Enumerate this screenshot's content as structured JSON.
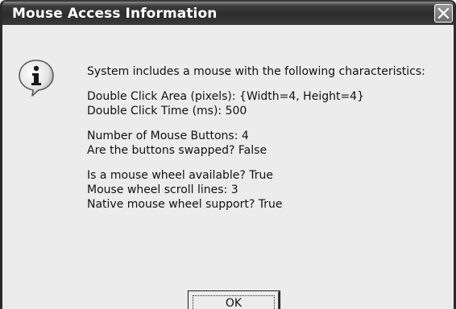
{
  "window": {
    "title": "Mouse Access Information"
  },
  "icons": {
    "info": "info-icon",
    "close": "close-icon"
  },
  "message": {
    "intro": "System includes a mouse with the following characteristics:",
    "double_click_area": "Double Click Area (pixels): {Width=4, Height=4}",
    "double_click_time": "Double Click Time (ms): 500",
    "button_count": "Number of Mouse Buttons: 4",
    "buttons_swapped": "Are the buttons swapped? False",
    "wheel_available": "Is a mouse wheel available? True",
    "wheel_scroll_lines": "Mouse wheel scroll lines: 3",
    "native_wheel_support": "Native mouse wheel support? True"
  },
  "buttons": {
    "ok_label": "OK"
  }
}
